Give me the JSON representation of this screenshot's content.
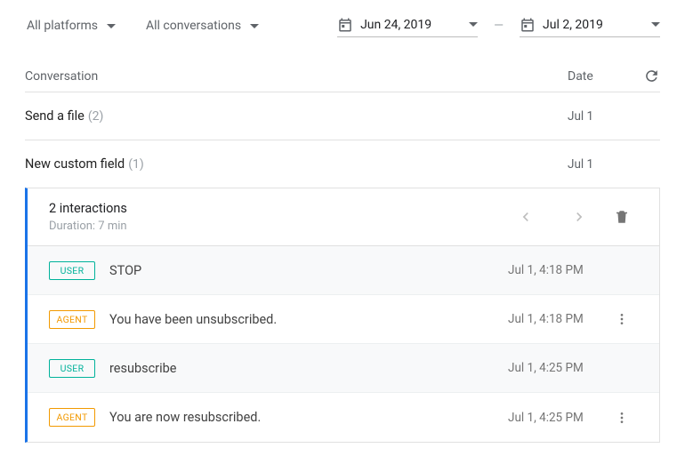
{
  "filters": {
    "platform_label": "All platforms",
    "conversations_label": "All conversations",
    "date_from": "Jun 24, 2019",
    "date_to": "Jul 2, 2019",
    "date_dash": "—"
  },
  "columns": {
    "conversation": "Conversation",
    "date": "Date"
  },
  "rows": [
    {
      "title": "Send a file",
      "count": "(2)",
      "date": "Jul 1"
    },
    {
      "title": "New custom field",
      "count": "(1)",
      "date": "Jul 1"
    }
  ],
  "expanded": {
    "interactions": "2 interactions",
    "duration": "Duration: 7 min",
    "messages": [
      {
        "role": "USER",
        "text": "STOP",
        "time": "Jul 1, 4:18 PM",
        "menu": false,
        "alt": true
      },
      {
        "role": "AGENT",
        "text": "You have been unsubscribed.",
        "time": "Jul 1, 4:18 PM",
        "menu": true,
        "alt": false
      },
      {
        "role": "USER",
        "text": "resubscribe",
        "time": "Jul 1, 4:25 PM",
        "menu": false,
        "alt": true
      },
      {
        "role": "AGENT",
        "text": "You are now resubscribed.",
        "time": "Jul 1, 4:25 PM",
        "menu": true,
        "alt": false
      }
    ]
  }
}
